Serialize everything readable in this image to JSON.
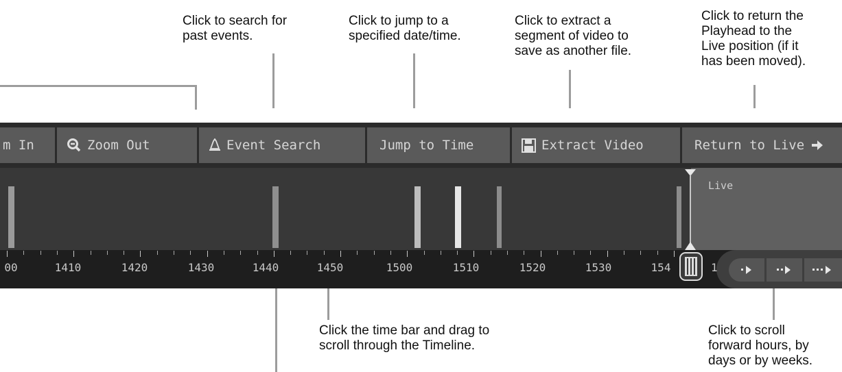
{
  "annotations": {
    "search": "Click to search for\npast events.",
    "jump": "Click to jump to a\nspecified date/time.",
    "extract": "Click to extract a\nsegment of video to\nsave as another file.",
    "return": "Click to return the\nPlayhead to the\nLive position (if it\nhas been moved).",
    "drag": "Click the time bar and drag to\nscroll through the Timeline.",
    "scroll": "Click to scroll\nforward hours, by\ndays or by weeks."
  },
  "toolbar": {
    "zoom_in_label": "m In",
    "zoom_out_label": "Zoom Out",
    "event_search_label": "Event Search",
    "jump_to_time_label": "Jump to Time",
    "extract_video_label": "Extract Video",
    "return_to_live_label": "Return to Live"
  },
  "timeline": {
    "live_label": "Live",
    "ruler_labels": [
      "00",
      "1410",
      "1420",
      "1430",
      "1440",
      "1450",
      "1500",
      "1510",
      "1520",
      "1530",
      "154",
      "1"
    ]
  },
  "colors": {
    "toolbar_bg": "#2b2b2b",
    "button_bg": "#5a5a5a",
    "track_bg": "#383838",
    "ruler_bg": "#1e1e1e",
    "live_bg": "#606060",
    "event_bar": "#9a9a9a",
    "event_bar_bright": "#e6e6e6",
    "leader_line": "#9c9c9c"
  },
  "icons": {
    "zoom_out": "magnifier-minus-icon",
    "event_search": "bell-icon",
    "extract_video": "floppy-disk-icon",
    "return_to_live": "arrow-right-icon",
    "scroll_hours": "arrow-right-icon",
    "scroll_days": "double-dot-arrow-right-icon",
    "scroll_weeks": "triple-dot-arrow-right-icon"
  }
}
